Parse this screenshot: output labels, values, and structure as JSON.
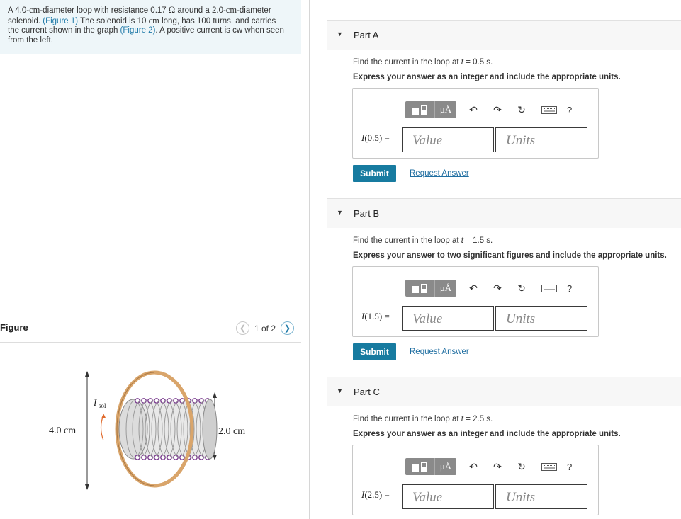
{
  "problem": {
    "t1": "A 4.0-",
    "t2": "cm",
    "t3": "-diameter loop with resistance 0.17 ",
    "t4": "Ω",
    "t5": " around a 2.0-",
    "t6": "cm",
    "t7": "-diameter",
    "t8": "solenoid. ",
    "t9": "(Figure 1)",
    "t10": " The solenoid is 10 ",
    "t11": "cm",
    "t12": " long, has 100 turns, and carries",
    "t13": "the current shown in the graph ",
    "t14": "(Figure 2)",
    "t15": ". A positive current is cw when seen",
    "t16": "from the left."
  },
  "figure": {
    "title": "Figure",
    "counter": "1 of 2",
    "prev_icon": "chevron-left-icon",
    "next_icon": "chevron-right-icon",
    "label_loop": "4.0 cm",
    "label_sol": "2.0 cm",
    "label_I": "I",
    "label_I_sub": "sol"
  },
  "toolbar": {
    "template_icon": "templates-icon",
    "units_label": "μÅ",
    "undo_icon": "undo-icon",
    "redo_icon": "redo-icon",
    "reset_icon": "reset-icon",
    "keyboard_icon": "keyboard-icon",
    "help_label": "?"
  },
  "parts": [
    {
      "title": "Part A",
      "q_pre": "Find the current in the loop at ",
      "q_var": "t",
      "q_post": " = 0.5 s.",
      "instruction": "Express your answer as an integer and include the appropriate units.",
      "expr_var": "I",
      "expr_arg": "(0.5) =",
      "value_placeholder": "Value",
      "units_placeholder": "Units",
      "submit": "Submit",
      "request": "Request Answer"
    },
    {
      "title": "Part B",
      "q_pre": "Find the current in the loop at ",
      "q_var": "t",
      "q_post": " = 1.5 s.",
      "instruction": "Express your answer to two significant figures and include the appropriate units.",
      "expr_var": "I",
      "expr_arg": "(1.5) =",
      "value_placeholder": "Value",
      "units_placeholder": "Units",
      "submit": "Submit",
      "request": "Request Answer"
    },
    {
      "title": "Part C",
      "q_pre": "Find the current in the loop at ",
      "q_var": "t",
      "q_post": " = 2.5 s.",
      "instruction": "Express your answer as an integer and include the appropriate units.",
      "expr_var": "I",
      "expr_arg": "(2.5) =",
      "value_placeholder": "Value",
      "units_placeholder": "Units"
    }
  ]
}
